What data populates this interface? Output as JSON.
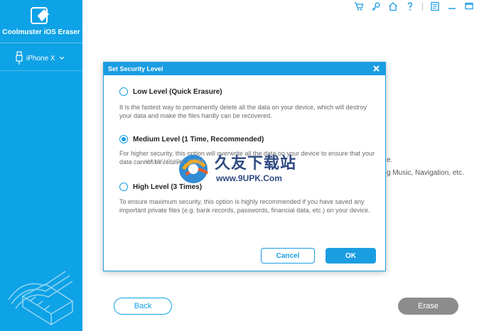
{
  "app": {
    "title": "Coolmuster iOS Eraser",
    "device_label": "iPhone X"
  },
  "toolbar": {
    "icons": [
      "cart-icon",
      "key-icon",
      "home-icon",
      "help-icon",
      "feedback-icon",
      "minimize-icon",
      "maximize-icon"
    ]
  },
  "background": {
    "line1": "e.",
    "line2": "g Music, Navigation, etc."
  },
  "buttons": {
    "back": "Back",
    "erase": "Erase"
  },
  "dialog": {
    "title": "Set Security Level",
    "options": [
      {
        "title": "Low Level (Quick Erasure)",
        "desc": "It is the fastest way to permanently delete all the data on your device, which will destroy your data and make the files hardly can be recovered.",
        "checked": false
      },
      {
        "title": "Medium Level (1 Time, Recommended)",
        "desc": "For higher security, this option will overwrite all the data on your device to ensure that your data cannot be recovered.",
        "checked": true
      },
      {
        "title": "High Level (3 Times)",
        "desc": "To ensure maximum security, this option is highly recommended if you have saved any important private files (e.g. bank records, passwords, financial data, etc.) on your device.",
        "checked": false
      }
    ],
    "cancel": "Cancel",
    "ok": "OK"
  },
  "watermark": {
    "chinese": "久友下载站",
    "url": "www.9UPK.Com",
    "url_small": "WWW.9UPK.COM"
  },
  "colors": {
    "accent": "#1b9de2",
    "sidebar": "#0ea2e6",
    "erase_button": "#8c8c8c"
  }
}
